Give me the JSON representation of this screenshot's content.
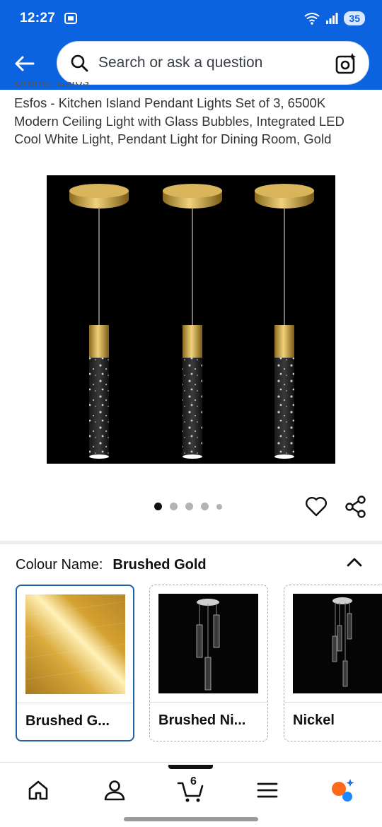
{
  "status_bar": {
    "time": "12:27",
    "battery": "35"
  },
  "search": {
    "placeholder": "Search or ask a question"
  },
  "product": {
    "title_cut": "Brand: Esfos",
    "title": "Esfos - Kitchen Island Pendant Lights Set of 3, 6500K Modern Ceiling Light with Glass Bubbles, Integrated LED Cool White Light, Pendant Light for Dining Room, Gold",
    "image_count": 5,
    "active_image": 1
  },
  "colour": {
    "label": "Colour Name:",
    "selected": "Brushed Gold",
    "options": [
      {
        "label": "Brushed G...",
        "selected": true
      },
      {
        "label": "Brushed Ni...",
        "selected": false
      },
      {
        "label": "Nickel",
        "selected": false
      }
    ]
  },
  "nav": {
    "cart_count": "6"
  },
  "colors": {
    "brand_blue": "#0b63e0",
    "selected_border": "#2162a1",
    "gold": "#c9a227"
  },
  "icons": [
    "back-arrow-icon",
    "search-icon",
    "camera-lens-icon",
    "heart-icon",
    "share-icon",
    "chevron-up-icon",
    "home-icon",
    "account-icon",
    "cart-icon",
    "menu-icon",
    "rufus-icon"
  ]
}
